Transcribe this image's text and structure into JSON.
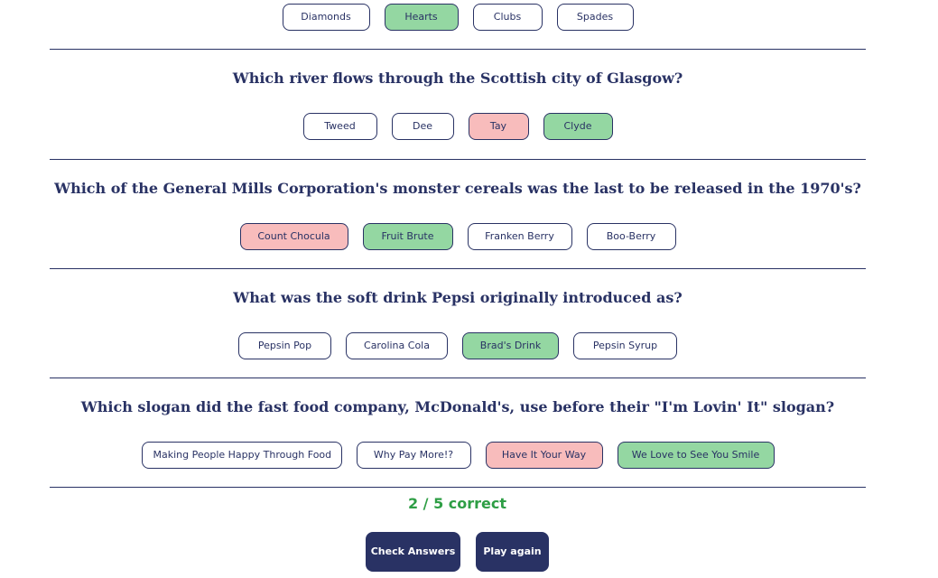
{
  "questions": [
    {
      "text": "",
      "answers": [
        {
          "label": "Diamonds",
          "state": "neutral"
        },
        {
          "label": "Hearts",
          "state": "correct"
        },
        {
          "label": "Clubs",
          "state": "neutral"
        },
        {
          "label": "Spades",
          "state": "neutral"
        }
      ]
    },
    {
      "text": "Which river flows through the Scottish city of Glasgow?",
      "answers": [
        {
          "label": "Tweed",
          "state": "neutral"
        },
        {
          "label": "Dee",
          "state": "neutral"
        },
        {
          "label": "Tay",
          "state": "wrong"
        },
        {
          "label": "Clyde",
          "state": "correct"
        }
      ]
    },
    {
      "text": "Which of the General Mills Corporation's monster cereals was the last to be released in the 1970's?",
      "answers": [
        {
          "label": "Count Chocula",
          "state": "wrong"
        },
        {
          "label": "Fruit Brute",
          "state": "correct"
        },
        {
          "label": "Franken Berry",
          "state": "neutral"
        },
        {
          "label": "Boo-Berry",
          "state": "neutral"
        }
      ]
    },
    {
      "text": "What was the soft drink Pepsi originally introduced as?",
      "answers": [
        {
          "label": "Pepsin Pop",
          "state": "neutral"
        },
        {
          "label": "Carolina Cola",
          "state": "neutral"
        },
        {
          "label": "Brad's Drink",
          "state": "correct"
        },
        {
          "label": "Pepsin Syrup",
          "state": "neutral"
        }
      ]
    },
    {
      "text": "Which slogan did the fast food company, McDonald's, use before their \"I'm Lovin' It\" slogan?",
      "answers": [
        {
          "label": "Making People Happy Through Food",
          "state": "neutral"
        },
        {
          "label": "Why Pay More!?",
          "state": "neutral"
        },
        {
          "label": "Have It Your Way",
          "state": "wrong"
        },
        {
          "label": "We Love to See You Smile",
          "state": "correct"
        }
      ]
    }
  ],
  "score": {
    "text": "2 / 5 correct"
  },
  "buttons": {
    "check_label": "Check Answers",
    "play_label": "Play again"
  },
  "colors": {
    "primary": "#293264",
    "correct": "#94d7a2",
    "wrong": "#f8bcbc",
    "score": "#2e9e45"
  }
}
